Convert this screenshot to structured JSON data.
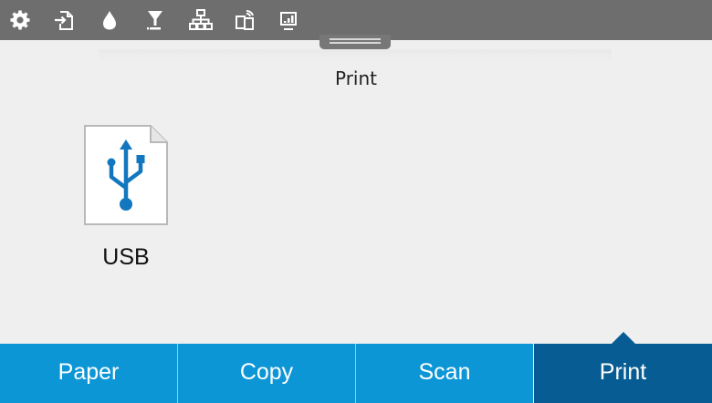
{
  "status_bar": {
    "icons": [
      "settings-icon",
      "sign-in-icon",
      "ink-drop-icon",
      "toner-icon",
      "network-icon",
      "wifi-direct-icon",
      "wireless-icon"
    ]
  },
  "page": {
    "title": "Print"
  },
  "sources": [
    {
      "label": "USB",
      "icon": "usb-icon"
    }
  ],
  "bottom_nav": {
    "tabs": [
      {
        "label": "Paper"
      },
      {
        "label": "Copy"
      },
      {
        "label": "Scan"
      },
      {
        "label": "Print",
        "active": true
      }
    ]
  },
  "colors": {
    "nav_tab": "#0d96d6",
    "nav_tab_active": "#075d93",
    "usb_icon": "#1277bf",
    "status_bar": "#6e6e6e"
  }
}
